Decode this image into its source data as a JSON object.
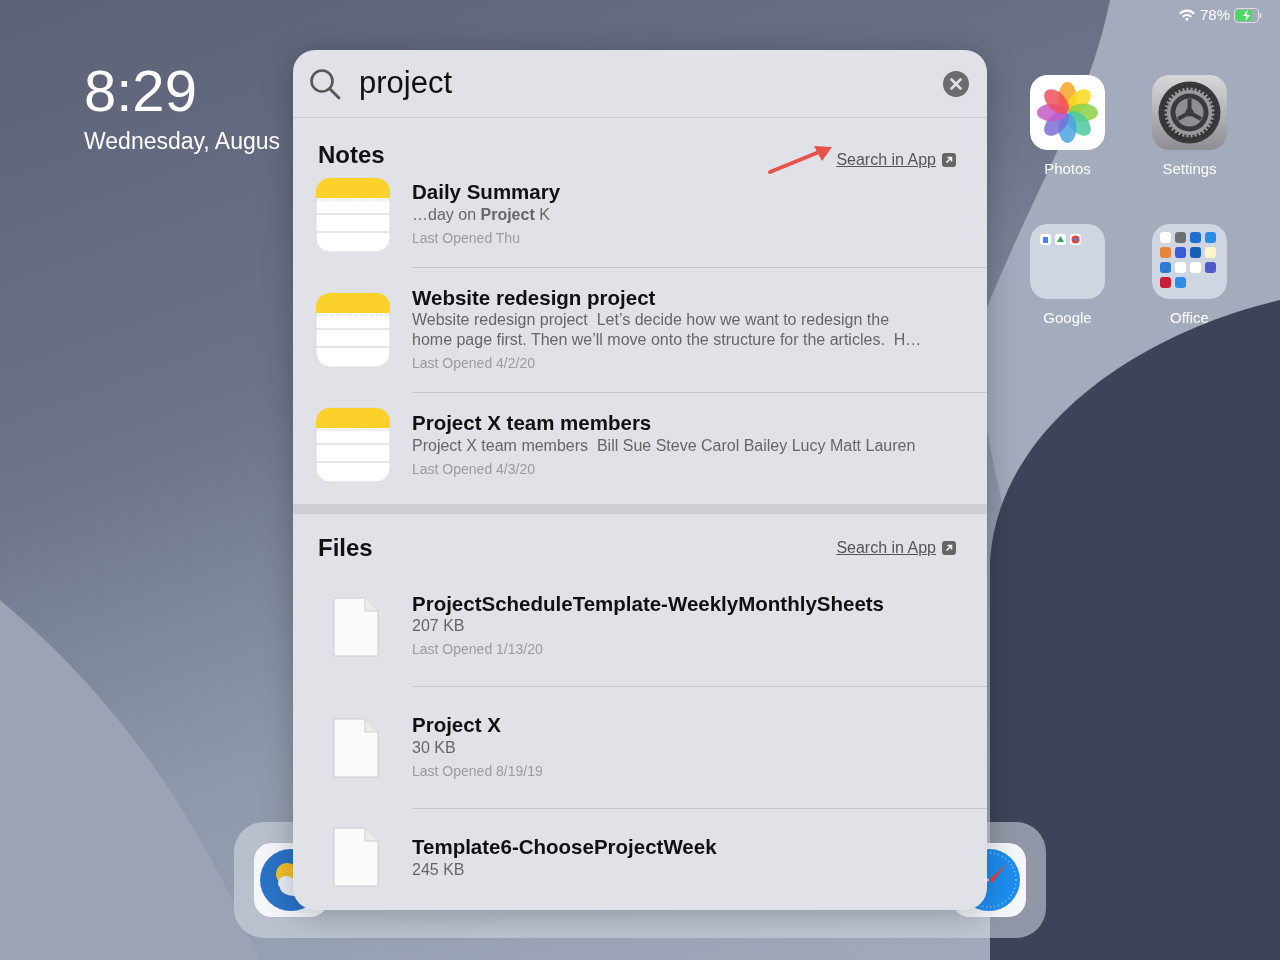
{
  "status_bar": {
    "battery": "78%"
  },
  "lock_screen": {
    "time": "8:29",
    "date": "Wednesday, Augus"
  },
  "apps": [
    {
      "label": "Photos",
      "kind": "photos"
    },
    {
      "label": "Settings",
      "kind": "settings"
    },
    {
      "label": "Google",
      "kind": "google-folder"
    },
    {
      "label": "Office",
      "kind": "office-folder"
    }
  ],
  "dock": [
    {
      "kind": "weather"
    },
    {
      "kind": "safari"
    }
  ],
  "search": {
    "value": "project"
  },
  "sections": [
    {
      "title": "Notes",
      "link": "Search in App",
      "kind": "notes",
      "results": [
        {
          "title": "Daily Summary",
          "snippet": "…day on **Project** K",
          "meta": "Last Opened Thu"
        },
        {
          "title": "Website redesign project",
          "snippet": "Website redesign project  Let’s decide how we want to redesign the home page first. Then we’ll move onto the structure for the articles.  H…",
          "meta": "Last Opened 4/2/20"
        },
        {
          "title": "Project X team members",
          "snippet": "Project X team members  Bill Sue Steve Carol Bailey Lucy Matt Lauren",
          "meta": "Last Opened 4/3/20"
        }
      ]
    },
    {
      "title": "Files",
      "link": "Search in App",
      "kind": "files",
      "results": [
        {
          "title": "ProjectScheduleTemplate-WeeklyMonthlySheets",
          "snippet": "207 KB",
          "meta": "Last Opened 1/13/20"
        },
        {
          "title": "Project X",
          "snippet": "30 KB",
          "meta": "Last Opened 8/19/19"
        },
        {
          "title": "Template6-ChooseProjectWeek",
          "snippet": "245 KB"
        }
      ]
    }
  ]
}
